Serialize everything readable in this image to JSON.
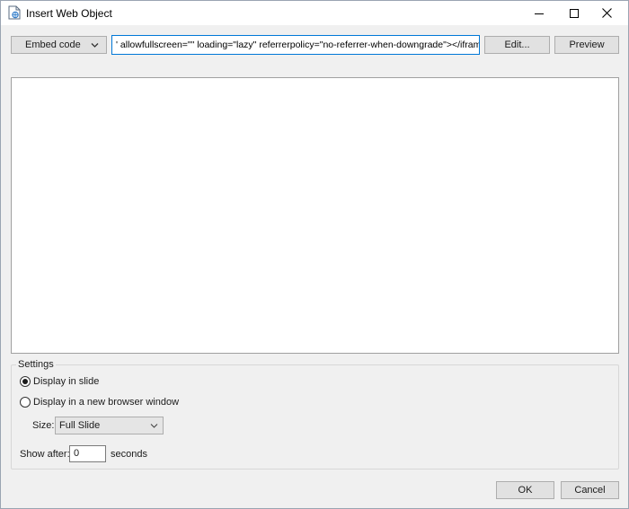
{
  "window": {
    "title": "Insert Web Object"
  },
  "toolbar": {
    "source_type": "Embed code",
    "code_value": "' allowfullscreen=\"\" loading=\"lazy\" referrerpolicy=\"no-referrer-when-downgrade\"></iframe>",
    "edit_label": "Edit...",
    "preview_label": "Preview"
  },
  "settings": {
    "group_label": "Settings",
    "display_in_slide": "Display in slide",
    "display_in_browser": "Display in a new browser window",
    "selected_display": "Display in slide",
    "size_label": "Size:",
    "size_value": "Full Slide",
    "show_after_label": "Show after:",
    "show_after_value": "0",
    "seconds_label": "seconds"
  },
  "footer": {
    "ok_label": "OK",
    "cancel_label": "Cancel"
  },
  "icons": {
    "title": "web-object-icon",
    "minimize": "minimize-icon",
    "maximize": "maximize-icon",
    "close": "close-icon",
    "dropdown": "chevron-down-icon"
  },
  "colors": {
    "focus_border": "#0078d7",
    "window_bg": "#f0f0f0",
    "button_bg": "#e1e1e1"
  }
}
